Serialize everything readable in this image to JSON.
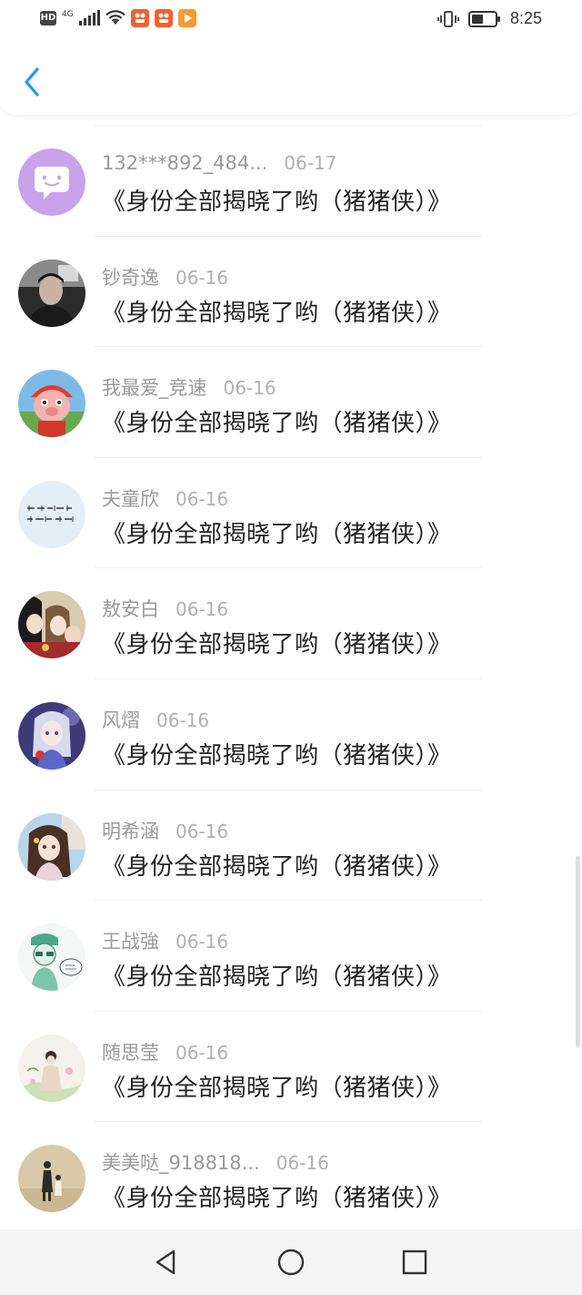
{
  "status_bar": {
    "hd": "HD",
    "network": "4G",
    "time": "8:25",
    "badges": [
      {
        "icon": "app-badge-1",
        "color": "#f1612f"
      },
      {
        "icon": "app-badge-2",
        "color": "#f1612f"
      },
      {
        "icon": "app-badge-3",
        "color": "#f39b36"
      }
    ]
  },
  "header": {
    "back_icon": "chevron-left-icon",
    "accent": "#1e9be9"
  },
  "items": [
    {
      "username": "132***892_484...",
      "date": "06-17",
      "title": "《身份全部揭晓了哟（猪猪侠）》",
      "avatar": "chat-bubble-avatar"
    },
    {
      "username": "钞奇逸",
      "date": "06-16",
      "title": "《身份全部揭晓了哟（猪猪侠）》",
      "avatar": "photo-avatar"
    },
    {
      "username": "我最爱_竞速",
      "date": "06-16",
      "title": "《身份全部揭晓了哟（猪猪侠）》",
      "avatar": "cartoon-pig-avatar"
    },
    {
      "username": "夫童欣",
      "date": "06-16",
      "title": "《身份全部揭晓了哟（猪猪侠）》",
      "avatar": "handwriting-avatar"
    },
    {
      "username": "敖安白",
      "date": "06-16",
      "title": "《身份全部揭晓了哟（猪猪侠）》",
      "avatar": "anime-group-avatar"
    },
    {
      "username": "风熠",
      "date": "06-16",
      "title": "《身份全部揭晓了哟（猪猪侠）》",
      "avatar": "anime-girl-avatar"
    },
    {
      "username": "明希涵",
      "date": "06-16",
      "title": "《身份全部揭晓了哟（猪猪侠）》",
      "avatar": "anime-portrait-avatar"
    },
    {
      "username": "王战強",
      "date": "06-16",
      "title": "《身份全部揭晓了哟（猪猪侠）》",
      "avatar": "sketch-avatar"
    },
    {
      "username": "随思莹",
      "date": "06-16",
      "title": "《身份全部揭晓了哟（猪猪侠）》",
      "avatar": "illustration-avatar"
    },
    {
      "username": "美美哒_918818...",
      "date": "06-16",
      "title": "《身份全部揭晓了哟（猪猪侠）》",
      "avatar": "silhouette-avatar"
    }
  ],
  "nav_bar": {
    "back": "triangle-back-icon",
    "home": "circle-home-icon",
    "recent": "square-recent-icon"
  }
}
